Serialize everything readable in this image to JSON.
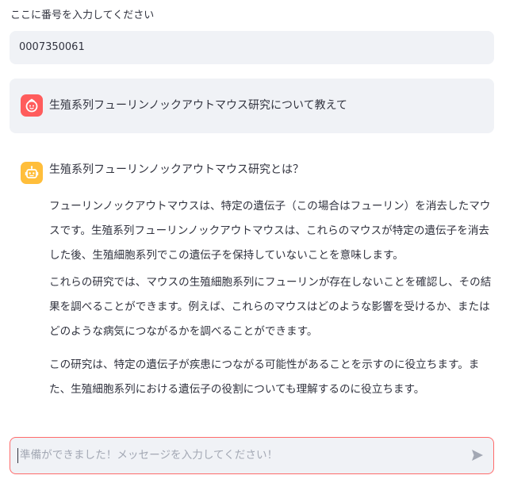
{
  "number_field": {
    "label": "ここに番号を入力してください",
    "value": "0007350061"
  },
  "messages": {
    "user": {
      "avatar_icon": "user-face-icon",
      "avatar_color": "#ff5c5c",
      "text": "生殖系列フューリンノックアウトマウス研究について教えて"
    },
    "assistant": {
      "avatar_icon": "robot-face-icon",
      "avatar_color": "#ffbe3b",
      "heading": "生殖系列フューリンノックアウトマウス研究とは？",
      "paragraphs": [
        "フューリンノックアウトマウスは、特定の遺伝子（この場合はフューリン）を消去したマウスです。生殖系列フューリンノックアウトマウスは、これらのマウスが特定の遺伝子を消去した後、生殖細胞系列でこの遺伝子を保持していないことを意味します。",
        "これらの研究では、マウスの生殖細胞系列にフューリンが存在しないことを確認し、その結果を調べることができます。例えば、これらのマウスはどのような影響を受けるか、またはどのような病気につながるかを調べることができます。",
        "この研究は、特定の遺伝子が疾患につながる可能性があることを示すのに役立ちます。また、生殖細胞系列における遺伝子の役割についても理解するのに役立ちます。"
      ]
    }
  },
  "chat_input": {
    "placeholder": "準備ができました！メッセージを入力してください！",
    "send_icon": "send-icon",
    "border_color": "#ff6b6b"
  }
}
